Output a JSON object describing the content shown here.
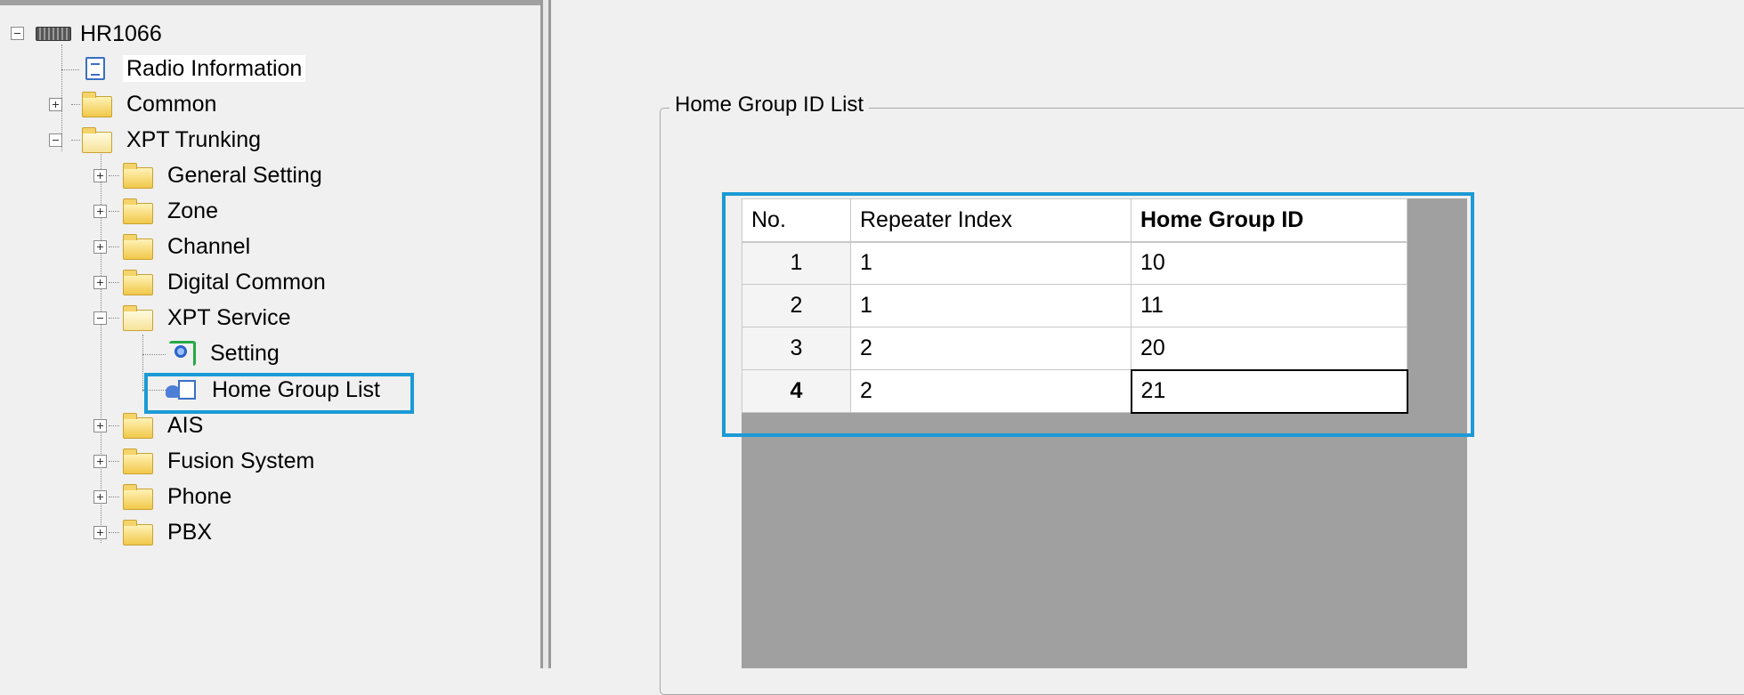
{
  "tree": {
    "root": "HR1066",
    "items": [
      {
        "label": "Radio Information"
      },
      {
        "label": "Common"
      },
      {
        "label": "XPT Trunking"
      },
      {
        "label": "General Setting"
      },
      {
        "label": "Zone"
      },
      {
        "label": "Channel"
      },
      {
        "label": "Digital Common"
      },
      {
        "label": "XPT Service"
      },
      {
        "label": "Setting"
      },
      {
        "label": "Home Group List"
      },
      {
        "label": "AIS"
      },
      {
        "label": "Fusion System"
      },
      {
        "label": "Phone"
      },
      {
        "label": "PBX"
      }
    ]
  },
  "panel": {
    "title": "Home Group ID List"
  },
  "grid": {
    "columns": [
      "No.",
      "Repeater Index",
      "Home Group ID"
    ],
    "rows": [
      {
        "no": "1",
        "repeater_index": "1",
        "home_group_id": "10"
      },
      {
        "no": "2",
        "repeater_index": "1",
        "home_group_id": "11"
      },
      {
        "no": "3",
        "repeater_index": "2",
        "home_group_id": "20"
      },
      {
        "no": "4",
        "repeater_index": "2",
        "home_group_id": "21"
      }
    ]
  },
  "colors": {
    "highlight": "#1b9ad6",
    "grid_background": "#a0a0a0"
  }
}
